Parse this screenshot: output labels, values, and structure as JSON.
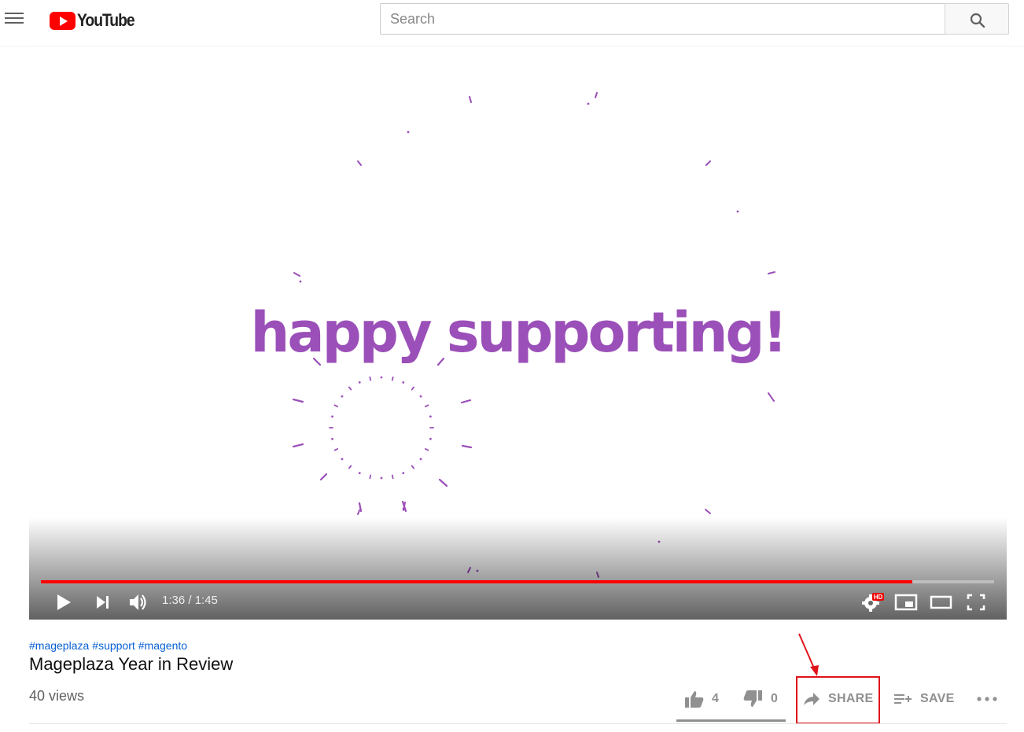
{
  "header": {
    "logo_text": "YouTube",
    "search_placeholder": "Search"
  },
  "player": {
    "overlay_text": "happy supporting!",
    "time_display": "1:36 / 1:45",
    "progress_fraction": 0.9143,
    "quality_badge": "HD",
    "accent_color": "#ff0000",
    "text_color": "#9b4fb8"
  },
  "video": {
    "hashtags": [
      "#mageplaza",
      "#support",
      "#magento"
    ],
    "title": "Mageplaza Year in Review",
    "views": "40 views"
  },
  "actions": {
    "like_count": "4",
    "dislike_count": "0",
    "share_label": "SHARE",
    "save_label": "SAVE"
  },
  "icons": [
    "menu-icon",
    "search-icon",
    "play-icon",
    "next-icon",
    "volume-icon",
    "settings-icon",
    "miniplayer-icon",
    "theater-icon",
    "fullscreen-icon",
    "thumbs-up-icon",
    "thumbs-down-icon",
    "share-icon",
    "playlist-add-icon",
    "more-icon"
  ]
}
